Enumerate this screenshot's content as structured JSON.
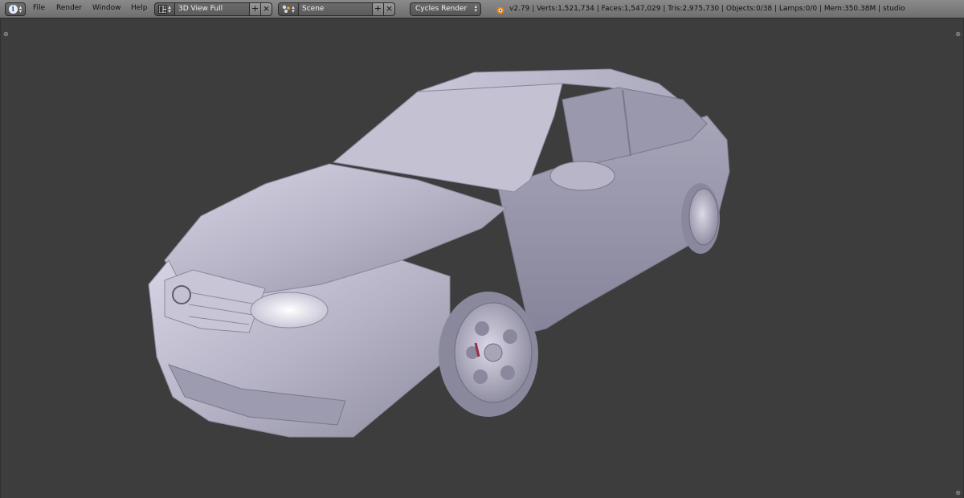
{
  "header": {
    "editor_icon": "info-icon",
    "menus": [
      "File",
      "Render",
      "Window",
      "Help"
    ],
    "screen_layout": {
      "icon": "layout-grid-icon",
      "value": "3D View Full"
    },
    "scene": {
      "icon": "scene-icon",
      "value": "Scene"
    },
    "render_engine": "Cycles Render",
    "logo": "blender-logo-icon",
    "stats": "v2.79 | Verts:1,521,734 | Faces:1,547,029 | Tris:2,975,730 | Objects:0/38 | Lamps:0/0 | Mem:350.38M | studio"
  },
  "viewport": {
    "background": "#3d3d3d",
    "model_color": "#b8b6c8",
    "object": "car-model"
  }
}
